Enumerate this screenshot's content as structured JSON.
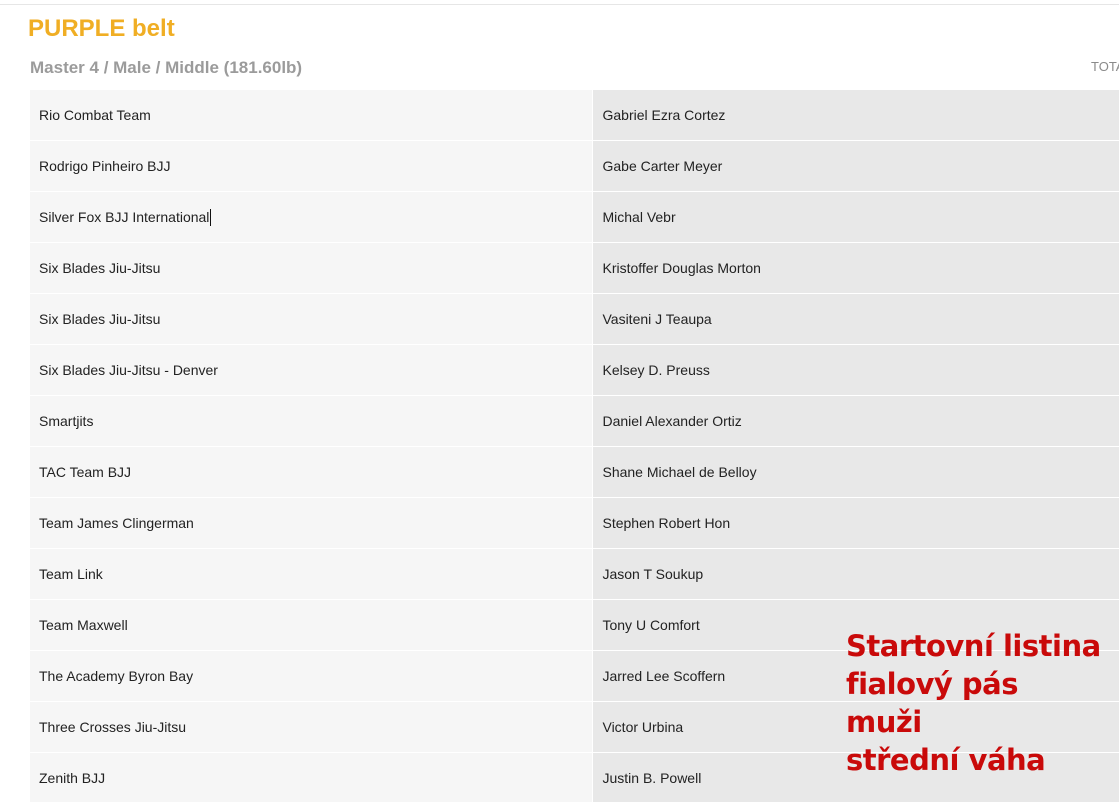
{
  "header": {
    "belt_title": "PURPLE belt",
    "category": "Master 4 / Male / Middle (181.60lb)",
    "total_label": "TOTA"
  },
  "rows": [
    {
      "team": "Rio Combat Team",
      "athlete": "Gabriel Ezra Cortez"
    },
    {
      "team": "Rodrigo Pinheiro BJJ",
      "athlete": "Gabe Carter Meyer"
    },
    {
      "team": "Silver Fox BJJ International",
      "athlete": "Michal Vebr"
    },
    {
      "team": "Six Blades Jiu-Jitsu",
      "athlete": "Kristoffer Douglas Morton"
    },
    {
      "team": "Six Blades Jiu-Jitsu",
      "athlete": "Vasiteni J Teaupa"
    },
    {
      "team": "Six Blades Jiu-Jitsu - Denver",
      "athlete": "Kelsey D. Preuss"
    },
    {
      "team": "Smartjits",
      "athlete": "Daniel Alexander Ortiz"
    },
    {
      "team": "TAC Team BJJ",
      "athlete": "Shane Michael de Belloy"
    },
    {
      "team": "Team James Clingerman",
      "athlete": "Stephen Robert Hon"
    },
    {
      "team": "Team Link",
      "athlete": "Jason T Soukup"
    },
    {
      "team": "Team Maxwell",
      "athlete": "Tony U Comfort"
    },
    {
      "team": "The Academy Byron Bay",
      "athlete": "Jarred Lee Scoffern"
    },
    {
      "team": "Three Crosses Jiu-Jitsu",
      "athlete": "Victor Urbina"
    },
    {
      "team": "Zenith BJJ",
      "athlete": "Justin B. Powell"
    }
  ],
  "annotation": {
    "lines": [
      "Startovní listina",
      "fialový pás",
      "muži",
      "střední váha"
    ]
  },
  "colors": {
    "belt_title": "#f0ae24",
    "annotation": "#c90a0a"
  }
}
